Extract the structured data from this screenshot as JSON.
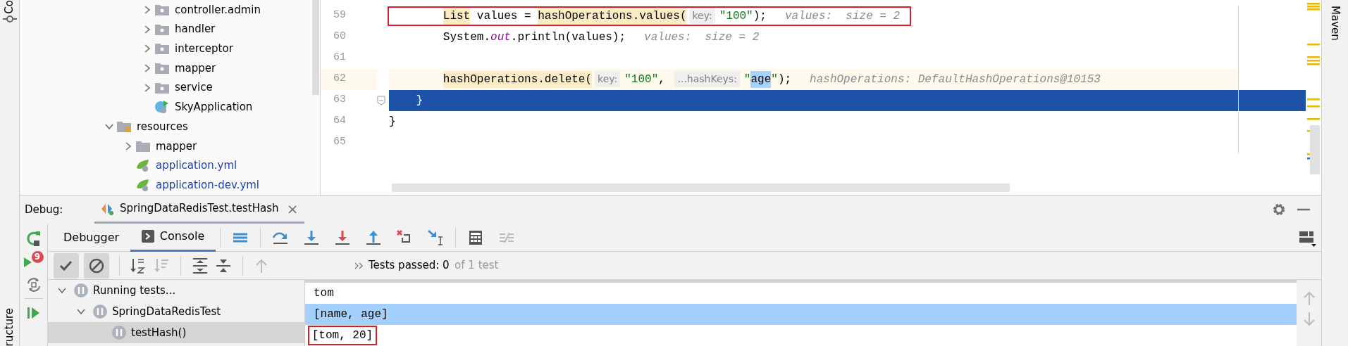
{
  "left_stripe": {
    "top_label": "Co",
    "bottom_label": "ructure"
  },
  "right_stripe": {
    "label": "Maven"
  },
  "project_tree": {
    "package_items": [
      {
        "label": "controller.admin",
        "kind": "package",
        "expanded": false,
        "color": "#000000"
      },
      {
        "label": "handler",
        "kind": "package",
        "expanded": false,
        "color": "#000000"
      },
      {
        "label": "interceptor",
        "kind": "package",
        "expanded": false,
        "color": "#000000"
      },
      {
        "label": "mapper",
        "kind": "package",
        "expanded": false,
        "color": "#000000"
      },
      {
        "label": "service",
        "kind": "package",
        "expanded": false,
        "color": "#000000"
      },
      {
        "label": "SkyApplication",
        "kind": "spring_class",
        "color": "#000000"
      }
    ],
    "items": [
      {
        "label": "resources",
        "kind": "resources",
        "expanded": true,
        "color": "#000000",
        "children": [
          {
            "label": "mapper",
            "kind": "folder",
            "expanded": false,
            "color": "#000000"
          },
          {
            "label": "application.yml",
            "kind": "yaml",
            "color": "#1a3fb0"
          },
          {
            "label": "application-dev.yml",
            "kind": "yaml",
            "color": "#1a3fb0"
          }
        ]
      }
    ]
  },
  "editor": {
    "lines": [
      {
        "number": "59",
        "current": false,
        "execution": false,
        "boxed": true,
        "tokens": [
          {
            "kind": "highlight",
            "text": "        List"
          },
          {
            "kind": "plain",
            "text": " values = "
          },
          {
            "kind": "highlight",
            "text": "hashOperations.values("
          },
          {
            "kind": "hint",
            "text": "key:"
          },
          {
            "kind": "string",
            "text": "\"100\""
          },
          {
            "kind": "plain",
            "text": ");"
          },
          {
            "kind": "inline_value",
            "text": "values:  size = 2"
          }
        ]
      },
      {
        "number": "60",
        "current": false,
        "execution": false,
        "boxed": false,
        "tokens": [
          {
            "kind": "plain",
            "text": "        System."
          },
          {
            "kind": "static_field",
            "text": "out"
          },
          {
            "kind": "plain",
            "text": ".println(values);"
          },
          {
            "kind": "inline_value",
            "text": "values:  size = 2"
          }
        ]
      },
      {
        "number": "61",
        "current": false,
        "execution": false
      },
      {
        "number": "62",
        "current": true,
        "execution": false,
        "boxed": false,
        "tokens": [
          {
            "kind": "highlight",
            "text": "        hashOperations.delete("
          },
          {
            "kind": "hint",
            "text": "key:"
          },
          {
            "kind": "string",
            "text": "\"100\""
          },
          {
            "kind": "plain",
            "text": ", "
          },
          {
            "kind": "hint",
            "text": "...hashKeys:"
          },
          {
            "kind": "string",
            "text": "\""
          },
          {
            "kind": "selection",
            "text": "age"
          },
          {
            "kind": "string",
            "text": "\""
          },
          {
            "kind": "plain",
            "text": ");"
          },
          {
            "kind": "inline_value",
            "text": "hashOperations: DefaultHashOperations@10153"
          }
        ]
      },
      {
        "number": "63",
        "current": false,
        "execution": true,
        "boxed": false,
        "tokens": [
          {
            "kind": "plain",
            "text": "    }"
          }
        ]
      },
      {
        "number": "64",
        "current": false,
        "execution": false,
        "boxed": false,
        "tokens": [
          {
            "kind": "plain",
            "text": "}"
          }
        ]
      },
      {
        "number": "65",
        "current": false,
        "execution": false
      }
    ]
  },
  "debug": {
    "title": "Debug:",
    "session_tab": {
      "label": "SpringDataRedisTest.testHash",
      "close": "×"
    },
    "breakpoint_badge": "9",
    "tabs": [
      {
        "label": "Debugger",
        "selected": false
      },
      {
        "label": "Console",
        "selected": true
      }
    ],
    "filters": [
      {
        "on": true
      },
      {
        "on": true
      }
    ],
    "status": {
      "passed": "Tests passed: 0",
      "total": "of 1 test"
    },
    "tests": [
      {
        "label": "Running tests...",
        "expanded": true,
        "selected": false,
        "children": [
          {
            "label": "SpringDataRedisTest",
            "expanded": true,
            "selected": false,
            "children": [
              {
                "label": "testHash()",
                "selected": true
              }
            ]
          }
        ]
      }
    ],
    "console": [
      {
        "text": "tom",
        "selected": false,
        "boxed": false
      },
      {
        "text": "[name, age]",
        "selected": true,
        "boxed": false
      },
      {
        "text": "[tom, 20]",
        "selected": false,
        "boxed": true
      }
    ]
  }
}
